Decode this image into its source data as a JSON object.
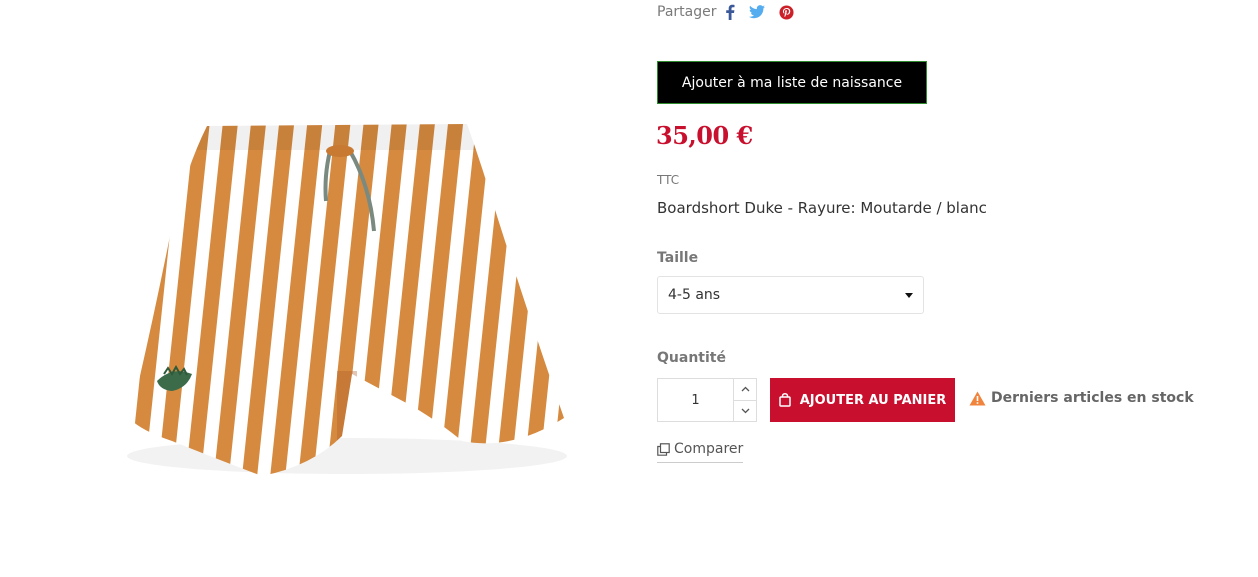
{
  "share": {
    "label": "Partager",
    "icons": [
      "facebook-icon",
      "twitter-icon",
      "pinterest-icon"
    ],
    "colors": {
      "facebook": "#3b5998",
      "twitter": "#55acee",
      "pinterest": "#cb2027"
    }
  },
  "wishlist": {
    "label": "Ajouter à ma liste de naissance"
  },
  "price": {
    "value": "35,00 €",
    "tax": "TTC",
    "color": "#c8102e"
  },
  "product": {
    "description": "Boardshort Duke - Rayure: Moutarde / blanc"
  },
  "size": {
    "label": "Taille",
    "selected": "4-5 ans"
  },
  "quantity": {
    "label": "Quantité",
    "value": "1"
  },
  "cart": {
    "label": "AJOUTER AU PANIER"
  },
  "stock": {
    "label": "Derniers articles en stock",
    "icon": "warning-icon",
    "color": "#f0843c"
  },
  "compare": {
    "label": "Comparer"
  }
}
